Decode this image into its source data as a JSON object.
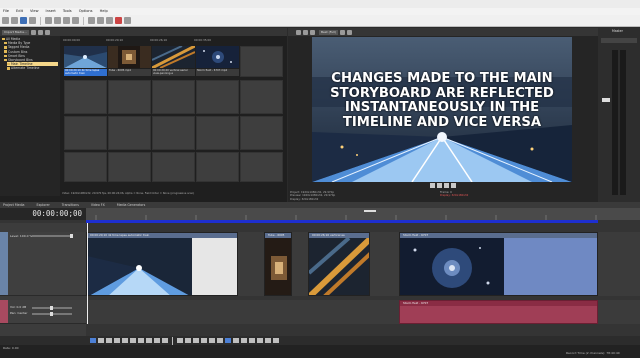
{
  "menu": [
    "File",
    "Edit",
    "View",
    "Insert",
    "Tools",
    "Options",
    "Help"
  ],
  "media": {
    "import_label": "Import Media...",
    "tree": [
      {
        "label": "All Media",
        "selected": false
      },
      {
        "label": "Media By Type",
        "selected": false
      },
      {
        "label": "Tagged Media",
        "selected": false
      },
      {
        "label": "Custom Bins",
        "selected": false
      },
      {
        "label": "Smart Bins",
        "selected": false
      },
      {
        "label": "Storyboard Bins",
        "selected": false
      },
      {
        "label": "Main Timeline",
        "selected": true
      },
      {
        "label": "Alternate Timeline",
        "selected": false
      }
    ],
    "thumbnails": [
      {
        "timecode": "00:00:00;00",
        "label": "00:00:20;10 4k time lapse automatic train",
        "selected": true
      },
      {
        "timecode": "00:00:20;10",
        "label": "Tube - 6005.mp4",
        "selected": false
      },
      {
        "timecode": "00:00:26;16",
        "label": "00:00:20;20 vertical aerial view-panning-a",
        "selected": false
      },
      {
        "timecode": "00:00:35;00",
        "label": "Storm field - 6707.mp4",
        "selected": false
      }
    ],
    "status": "Video: 1920x1080x32, 29.970 fps, 00:00:24;06, Alpha = None, Field Order = None (progressive scan)"
  },
  "tabs": [
    "Project Media",
    "Explorer",
    "Transitions",
    "Video FX",
    "Media Generators"
  ],
  "preview": {
    "overlay": "CHANGES MADE TO THE MAIN STORYBOARD ARE REFLECTED INSTANTANEOUSLY IN THE TIMELINE AND VICE VERSA",
    "quality": "Best (Full)",
    "info_project": "Project:   1920x1080x32, 29.970p",
    "info_preview": "Preview:  1920x1080x32, 29.970p",
    "info_display": "Display:  320x180x32",
    "info_frame_label": "Frame:",
    "info_frame_value": "0",
    "info_display_right": "Display:  320x180x32"
  },
  "timeline": {
    "time": "00:00:00;00",
    "level": "Level: 100.0 %",
    "vol": "Vol:   0.0 dB",
    "pan": "Pan:   Center",
    "rate": "Rate: 0.00",
    "clips": [
      {
        "title": "00:00:20;10 4k time lapse automatic train"
      },
      {
        "title": "Tube - 6005"
      },
      {
        "title": "00:00:26;16 vertical ae"
      },
      {
        "title": "Storm field - 6707"
      }
    ],
    "audio_clip": "Storm field - 6707",
    "record_time": "Record Time (2 channels): 78:40:40"
  },
  "master": {
    "label": "Master"
  }
}
